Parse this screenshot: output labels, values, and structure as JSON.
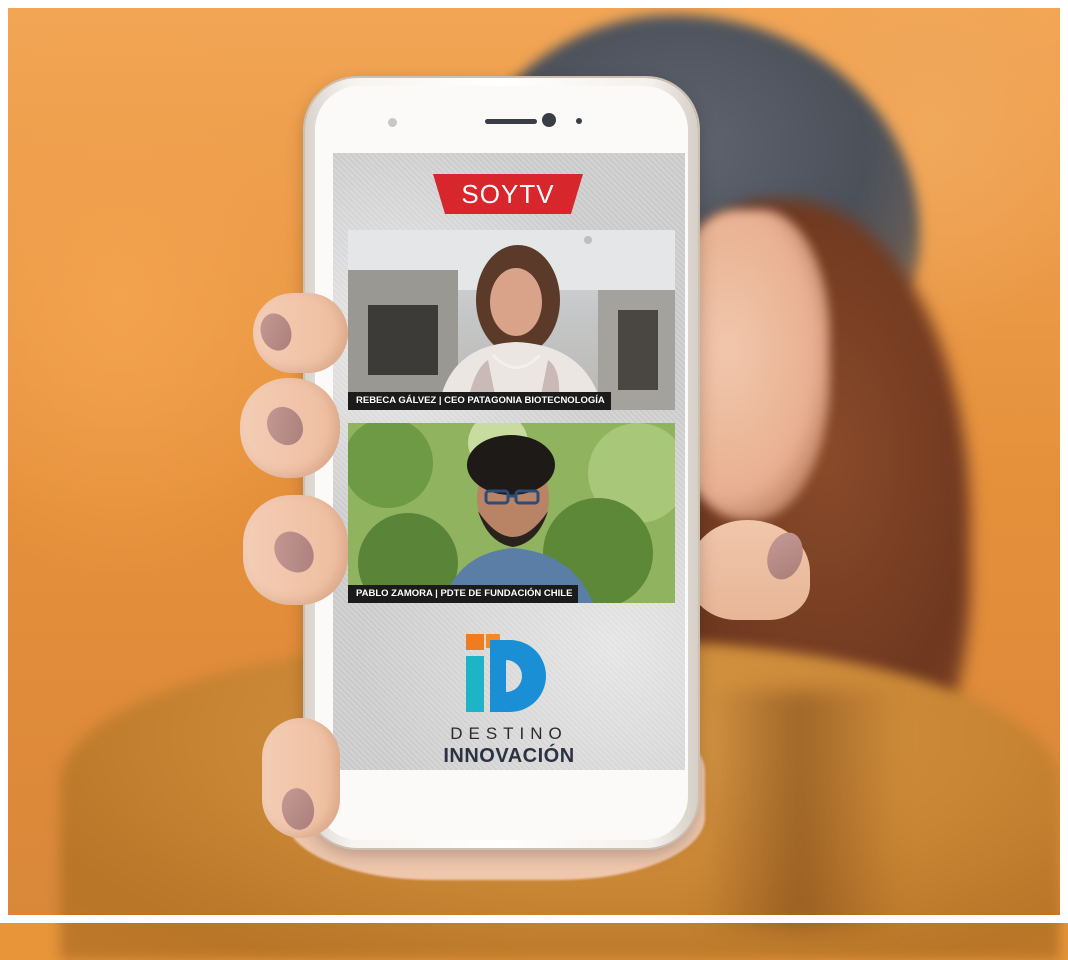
{
  "brand": {
    "channel_logo": "SOYTV"
  },
  "videos": [
    {
      "caption": "REBECA GÁLVEZ | CEO PATAGONIA BIOTECNOLOGÍA"
    },
    {
      "caption": "PABLO ZAMORA | PDTE DE FUNDACIÓN CHILE"
    }
  ],
  "footer_logo": {
    "line1": "DESTINO",
    "line2": "INNOVACIÓN"
  },
  "colors": {
    "background_orange": "#e8953a",
    "soytv_red": "#d8262d",
    "logo_orange": "#f07c22",
    "logo_blue": "#1a8fd6",
    "logo_teal": "#1fb3c6"
  }
}
